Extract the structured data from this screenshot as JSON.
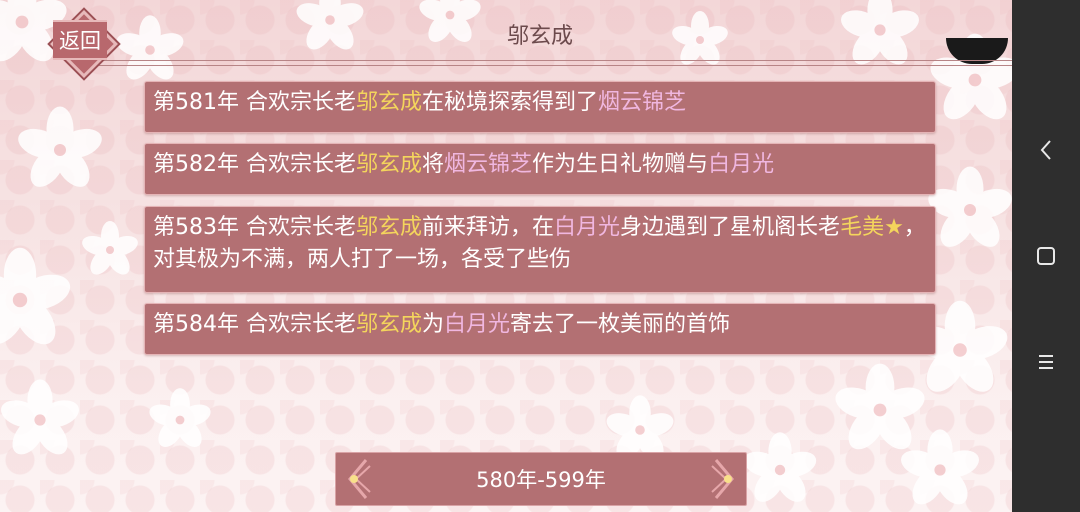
{
  "header": {
    "title": "邬玄成",
    "back_label": "返回"
  },
  "events": [
    {
      "segments": [
        {
          "text": "第581年 合欢宗长老",
          "style": "normal"
        },
        {
          "text": "邬玄成",
          "style": "gold"
        },
        {
          "text": "在秘境探索得到了",
          "style": "normal"
        },
        {
          "text": "烟云锦芝",
          "style": "pink"
        }
      ]
    },
    {
      "segments": [
        {
          "text": "第582年 合欢宗长老",
          "style": "normal"
        },
        {
          "text": "邬玄成",
          "style": "gold"
        },
        {
          "text": "将",
          "style": "normal"
        },
        {
          "text": "烟云锦芝",
          "style": "pink"
        },
        {
          "text": "作为生日礼物赠与",
          "style": "normal"
        },
        {
          "text": "白月光",
          "style": "pink"
        }
      ]
    },
    {
      "segments": [
        {
          "text": "第583年 合欢宗长老",
          "style": "normal"
        },
        {
          "text": "邬玄成",
          "style": "gold"
        },
        {
          "text": "前来拜访，在",
          "style": "normal"
        },
        {
          "text": "白月光",
          "style": "pink"
        },
        {
          "text": "身边遇到了星机阁长老",
          "style": "normal"
        },
        {
          "text": "毛美★",
          "style": "gold"
        },
        {
          "text": "，对其极为不满，两人打了一场，各受了些伤",
          "style": "normal"
        }
      ]
    },
    {
      "segments": [
        {
          "text": "第584年 合欢宗长老",
          "style": "normal"
        },
        {
          "text": "邬玄成",
          "style": "gold"
        },
        {
          "text": "为",
          "style": "normal"
        },
        {
          "text": "白月光",
          "style": "pink"
        },
        {
          "text": "寄去了一枚美丽的首饰",
          "style": "normal"
        }
      ]
    }
  ],
  "pager": {
    "range_label": "580年-599年"
  },
  "colors": {
    "row_bg": "#b37073",
    "highlight_gold": "#f4d55c",
    "highlight_pink": "#f0b7e0"
  },
  "icons": {
    "nav_back": "chevron-left-icon",
    "nav_home": "square-icon",
    "nav_menu": "menu-lines-icon"
  }
}
